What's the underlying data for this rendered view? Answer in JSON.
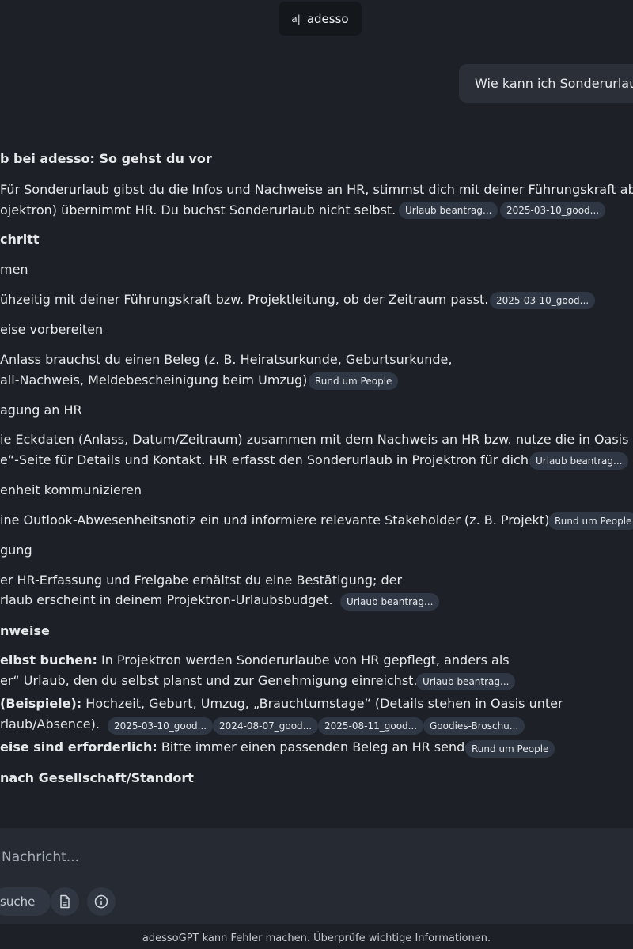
{
  "header": {
    "logo_mark": "a|",
    "brand": "adesso"
  },
  "user_message": "Wie kann ich Sonderurlaub",
  "answer": {
    "heading": "b bei adesso: So gehst du vor",
    "intro_line1": "Für Sonderurlaub gibst du die Infos und Nachweise an HR, stimmst dich mit deiner Führungskraft ab –",
    "intro_line2": "ojektron) übernimmt HR. Du buchst Sonderurlaub nicht selbst.",
    "intro_chips": [
      "Urlaub beantrag...",
      "2025-03-10_good..."
    ],
    "steps_heading": "chritt",
    "step1_title": "men",
    "step1_text": "ühzeitig mit deiner Führungskraft bzw. Projektleitung, ob der Zeitraum passt.",
    "step1_chip": "2025-03-10_good...",
    "step2_title": "eise vorbereiten",
    "step2_line1": "Anlass brauchst du einen Beleg (z. B. Heiratsurkunde, Geburtsurkunde,",
    "step2_line2": "all-Nachweis, Meldebescheinigung beim Umzug).",
    "step2_chip": "Rund um People",
    "step3_title": "agung an HR",
    "step3_line1": "ie Eckdaten (Anlass, Datum/Zeitraum) zusammen mit dem Nachweis an HR bzw. nutze die in Oasis ver",
    "step3_line2": "e“-Seite für Details und Kontakt. HR erfasst den Sonderurlaub in Projektron für dich.",
    "step3_chip": "Urlaub beantrag...",
    "step4_title": "enheit kommunizieren",
    "step4_text": "ine Outlook-Abwesenheitsnotiz ein und informiere relevante Stakeholder (z. B. Projekt).",
    "step4_chip": "Rund um People",
    "step5_title": "gung",
    "step5_line1": "er HR-Erfassung und Freigabe erhältst du eine Bestätigung; der",
    "step5_line2": "rlaub erscheint in deinem Projektron-Urlaubsbudget.",
    "step5_chip": "Urlaub beantrag...",
    "notes_heading": "nweise",
    "note1_bold": "elbst buchen:",
    "note1_rest": " In Projektron werden Sonderurlaube von HR gepflegt, anders als",
    "note1_line2": "er“ Urlaub, den du selbst planst und zur Genehmigung einreichst.",
    "note1_chip": "Urlaub beantrag...",
    "note2_bold": "(Beispiele):",
    "note2_rest": " Hochzeit, Geburt, Umzug, „Brauchtumstage“ (Details stehen in Oasis unter",
    "note2_line2": "rlaub/Absence).",
    "note2_chips": [
      "2025-03-10_good...",
      "2024-08-07_good...",
      "2025-08-11_good...",
      "Goodies-Broschu..."
    ],
    "note3_bold": "eise sind erforderlich:",
    "note3_rest": " Bitte immer einen passenden Beleg an HR senden.",
    "note3_chip": "Rund um People",
    "last_heading": "nach Gesellschaft/Standort"
  },
  "composer": {
    "placeholder": "Nachricht...",
    "search_label": "suche",
    "file_icon": "file-icon",
    "info_icon": "info-icon"
  },
  "footer": "adessoGPT kann Fehler machen. Überprüfe wichtige Informationen."
}
